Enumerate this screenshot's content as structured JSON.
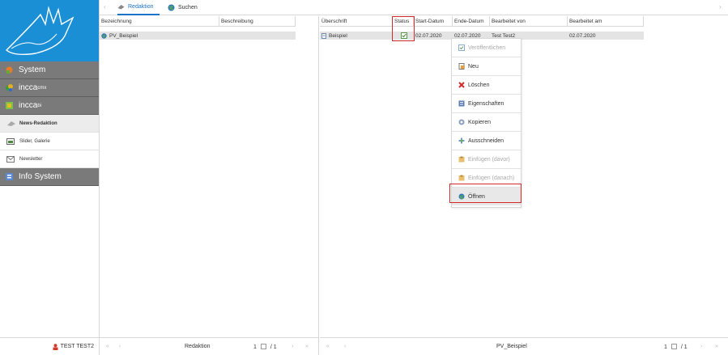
{
  "sidebar": {
    "main_items": [
      {
        "label": "System",
        "icon": "system-icon"
      },
      {
        "label": "incca",
        "sup": "cmx",
        "icon": "incca-cmx-icon"
      },
      {
        "label": "incca",
        "sup": "bi",
        "icon": "incca-bi-icon"
      }
    ],
    "sub_items": [
      {
        "label": "News-Redaktion",
        "icon": "news-icon",
        "active": true
      },
      {
        "label": "Slider, Galerie",
        "icon": "slider-icon",
        "active": false
      },
      {
        "label": "Newsletter",
        "icon": "newsletter-icon",
        "active": false
      }
    ],
    "info_system": {
      "label": "Info System",
      "icon": "info-system-icon"
    },
    "user": "TEST TEST2"
  },
  "tabs": [
    {
      "label": "Redaktion",
      "icon": "redaktion-icon",
      "active": true
    },
    {
      "label": "Suchen",
      "icon": "globe-icon",
      "active": false
    }
  ],
  "left_table": {
    "columns": [
      "Bezeichnung",
      "Beschreibung"
    ],
    "rows": [
      {
        "bezeichnung": "PV_Beispiel",
        "beschreibung": ""
      }
    ]
  },
  "right_table": {
    "columns": [
      "Überschrift",
      "Status",
      "Start-Datum",
      "Ende-Datum",
      "Bearbeitet von",
      "Bearbeitet am"
    ],
    "rows": [
      {
        "ueberschrift": "Beispiel",
        "status": "checked",
        "start": "02.07.2020",
        "ende": "02.07.2020",
        "von": "Test Test2",
        "am": "02.07.2020"
      }
    ]
  },
  "context_menu": [
    {
      "label": "Veröffentlichen",
      "icon": "publish-icon",
      "disabled": true
    },
    {
      "label": "Neu",
      "icon": "new-icon",
      "disabled": false
    },
    {
      "label": "Löschen",
      "icon": "delete-icon",
      "disabled": false
    },
    {
      "label": "Eigenschaften",
      "icon": "properties-icon",
      "disabled": false
    },
    {
      "label": "Kopieren",
      "icon": "copy-icon",
      "disabled": false
    },
    {
      "label": "Ausschneiden",
      "icon": "cut-icon",
      "disabled": false
    },
    {
      "label": "Einfügen (davor)",
      "icon": "paste-before-icon",
      "disabled": true
    },
    {
      "label": "Einfügen (danach)",
      "icon": "paste-after-icon",
      "disabled": true
    },
    {
      "label": "Öffnen",
      "icon": "open-icon",
      "disabled": false
    }
  ],
  "footer_left": {
    "label": "Redaktion",
    "page": "1",
    "total": "/ 1"
  },
  "footer_right": {
    "label": "PV_Beispiel",
    "page": "1",
    "total": "/ 1"
  },
  "colors": {
    "accent": "#1a73c8",
    "sidebar_dark": "#7a7a7a",
    "logo_bg": "#1b8fd6",
    "highlight": "#d12a2a"
  }
}
